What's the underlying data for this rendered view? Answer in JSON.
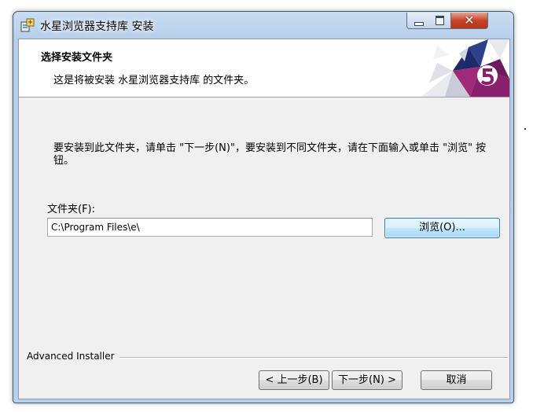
{
  "window": {
    "title": "水星浏览器支持库 安装",
    "close_glyph": "✕"
  },
  "banner": {
    "title": "选择安装文件夹",
    "subtitle": "这是将被安装 水星浏览器支持库 的文件夹。"
  },
  "body": {
    "instruction": "要安装到此文件夹，请单击 \"下一步(N)\"，要安装到不同文件夹，请在下面输入或单击 \"浏览\" 按钮。",
    "folder_label": "文件夹(F):",
    "folder_value": "C:\\Program Files\\e\\",
    "browse_label": "浏览(O)..."
  },
  "footer": {
    "brand": "Advanced Installer",
    "back_label": "< 上一步(B)",
    "next_label": "下一步(N) >",
    "cancel_label": "取消"
  },
  "colors": {
    "accent": "#3c7fb1",
    "close": "#c8442a",
    "logo_magenta": "#8a1f6e"
  },
  "icons": [
    "installer-app-icon",
    "minimize-icon",
    "maximize-icon",
    "close-icon",
    "advanced-installer-logo"
  ]
}
